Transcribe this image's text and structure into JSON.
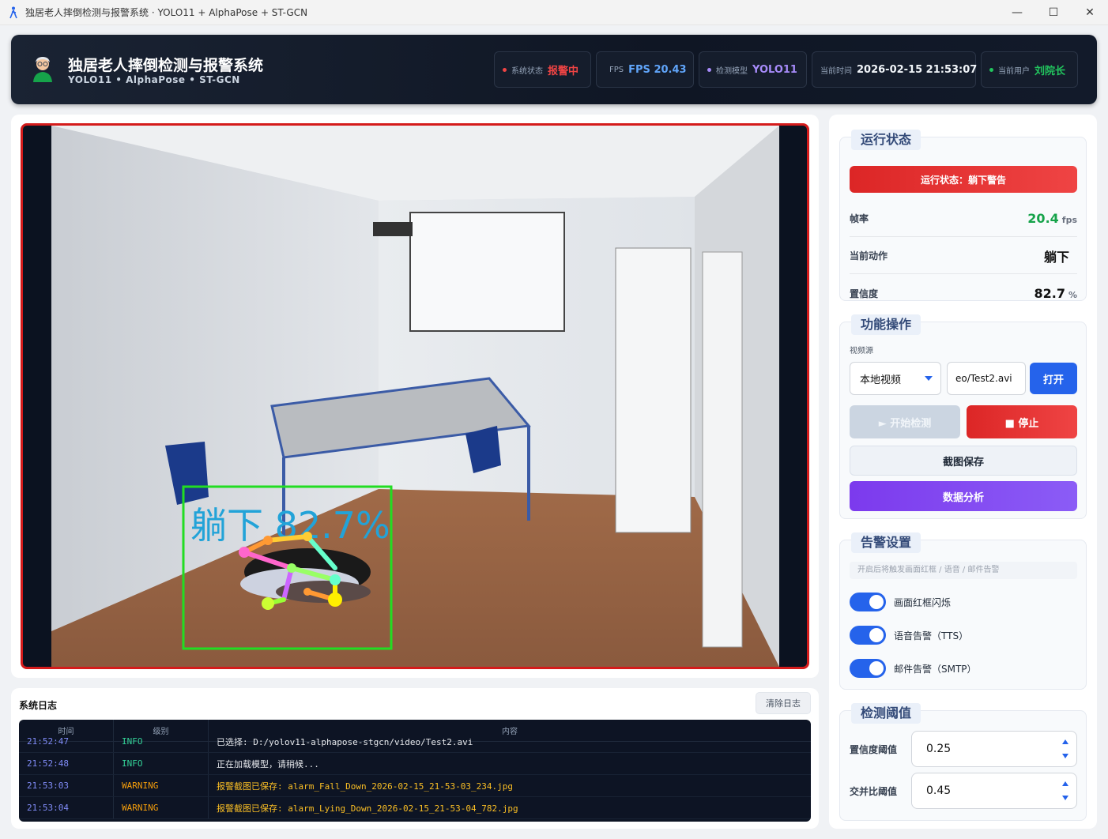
{
  "window": {
    "title": "独居老人摔倒检测与报警系统 · YOLO11 + AlphaPose + ST-GCN",
    "minimize": "—",
    "maximize": "☐",
    "close": "✕"
  },
  "header": {
    "title": "独居老人摔倒检测与报警系统",
    "subtitle": "YOLO11 • AlphaPose • ST-GCN",
    "status": {
      "label": "系统状态",
      "value": "报警中"
    },
    "fps": {
      "label": "FPS",
      "value": "FPS 20.43"
    },
    "model": {
      "label": "检测模型",
      "value": "YOLO11"
    },
    "time": {
      "label": "当前时间",
      "value": "2026-02-15 21:53:07"
    },
    "user": {
      "label": "当前用户",
      "value": "刘院长"
    }
  },
  "video": {
    "detection_label": "躺下 82.7%"
  },
  "log": {
    "title": "系统日志",
    "clear_label": "清除日志",
    "columns": [
      "时间",
      "级别",
      "内容"
    ],
    "rows": [
      {
        "time": "21:52:47",
        "level": "INFO",
        "message": "已选择: D:/yolov11-alphapose-stgcn/video/Test2.avi"
      },
      {
        "time": "21:52:48",
        "level": "INFO",
        "message": "正在加载模型，请稍候..."
      },
      {
        "time": "21:53:03",
        "level": "WARNING",
        "message": "报警截图已保存: alarm_Fall_Down_2026-02-15_21-53-03_234.jpg"
      },
      {
        "time": "21:53:04",
        "level": "WARNING",
        "message": "报警截图已保存: alarm_Lying_Down_2026-02-15_21-53-04_782.jpg"
      }
    ]
  },
  "run_state": {
    "title": "运行状态",
    "banner": "运行状态：躺下警告",
    "fps_label": "帧率",
    "fps_value": "20.4",
    "fps_unit": "fps",
    "action_label": "当前动作",
    "action_value": "躺下",
    "conf_label": "置信度",
    "conf_value": "82.7",
    "conf_unit": "%"
  },
  "functions": {
    "title": "功能操作",
    "source_label": "视频源",
    "source_value": "本地视频",
    "path_value": "eo/Test2.avi",
    "open_label": "打开",
    "start_label": "► 开始检测",
    "stop_label": "■ 停止",
    "screenshot_label": "截图保存",
    "analysis_label": "数据分析"
  },
  "alarm": {
    "title": "告警设置",
    "hint": "开启后将触发画面红框 / 语音 / 邮件告警",
    "toggles": [
      {
        "label": "画面红框闪烁",
        "on": true
      },
      {
        "label": "语音告警（TTS）",
        "on": true
      },
      {
        "label": "邮件告警（SMTP）",
        "on": true
      }
    ]
  },
  "threshold": {
    "title": "检测阈值",
    "conf_label": "置信度阈值",
    "conf_value": "0.25",
    "iou_label": "交并比阈值",
    "iou_value": "0.45"
  },
  "colors": {
    "danger": "#ef4444",
    "accent": "#2563eb",
    "purple": "#7c3aed",
    "success": "#16a34a"
  }
}
